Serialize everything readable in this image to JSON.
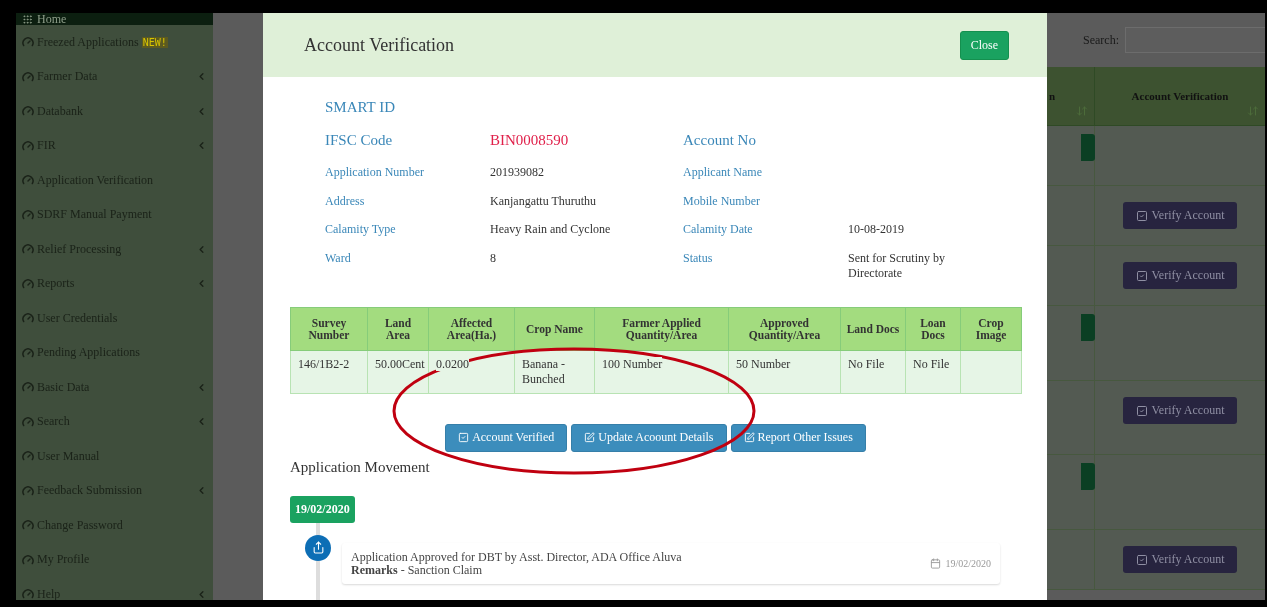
{
  "sidebar": {
    "items": [
      {
        "label": "Home",
        "kind": "header",
        "expandable": false
      },
      {
        "label": "Freezed Applications",
        "kind": "item",
        "badge": "NEW!",
        "expandable": false
      },
      {
        "label": "Farmer Data",
        "kind": "item",
        "expandable": true
      },
      {
        "label": "Databank",
        "kind": "item",
        "expandable": true
      },
      {
        "label": "FIR",
        "kind": "item",
        "expandable": true
      },
      {
        "label": "Application Verification",
        "kind": "item",
        "expandable": false
      },
      {
        "label": "SDRF Manual Payment",
        "kind": "item",
        "expandable": false
      },
      {
        "label": "Relief Processing",
        "kind": "item",
        "expandable": true
      },
      {
        "label": "Reports",
        "kind": "item",
        "expandable": true
      },
      {
        "label": "User Credentials",
        "kind": "item",
        "expandable": false
      },
      {
        "label": "Pending Applications",
        "kind": "item",
        "expandable": false
      },
      {
        "label": "Basic Data",
        "kind": "item",
        "expandable": true
      },
      {
        "label": "Search",
        "kind": "item",
        "expandable": true
      },
      {
        "label": "User Manual",
        "kind": "item",
        "expandable": false
      },
      {
        "label": "Feedback Submission",
        "kind": "item",
        "expandable": true
      },
      {
        "label": "Change Password",
        "kind": "item",
        "expandable": false
      },
      {
        "label": "My Profile",
        "kind": "item",
        "expandable": false
      },
      {
        "label": "Help",
        "kind": "item",
        "expandable": true
      }
    ]
  },
  "background": {
    "search_label": "Search:",
    "columns": [
      "n",
      "Account Verification"
    ],
    "rows": [
      {
        "kind": "action"
      },
      {
        "kind": "verify",
        "label": "Verify Account"
      },
      {
        "kind": "verify",
        "label": "Verify Account"
      },
      {
        "kind": "action"
      },
      {
        "kind": "verify",
        "label": "Verify Account"
      },
      {
        "kind": "action"
      },
      {
        "kind": "verify",
        "label": "Verify Account"
      }
    ]
  },
  "modal": {
    "title": "Account Verification",
    "close_button": "Close",
    "smart_id_label": "SMART ID",
    "main_fields": [
      {
        "label": "IFSC Code",
        "value": "BIN0008590"
      },
      {
        "label": "Account No"
      }
    ],
    "fields": [
      {
        "label": "Application Number",
        "value": "201939082"
      },
      {
        "label": "Applicant Name"
      },
      {
        "label": "Address",
        "value": "Kanjangattu Thuruthu"
      },
      {
        "label": "Mobile Number"
      },
      {
        "label": "Calamity Type",
        "value": "Heavy Rain and Cyclone"
      },
      {
        "label": "Calamity Date",
        "value": "10-08-2019"
      },
      {
        "label": "Ward",
        "value": "8"
      },
      {
        "label": "Status",
        "value": "Sent for Scrutiny by Directorate"
      }
    ],
    "table": {
      "columns": [
        "Survey Number",
        "Land Area",
        "Affected Area(Ha.)",
        "Crop Name",
        "Farmer Applied Quantity/Area",
        "Approved Quantity/Area",
        "Land Docs",
        "Loan Docs",
        "Crop Image"
      ],
      "rows": [
        [
          "146/1B2-2",
          "50.00Cent",
          "0.0200",
          "Banana - Bunched",
          "100 Number",
          "50 Number",
          "No File",
          "No File"
        ]
      ]
    },
    "actions": [
      {
        "label": "Account Verified"
      },
      {
        "label": "Update Acoount Details"
      },
      {
        "label": "Report Other Issues"
      }
    ],
    "movement": {
      "heading": "Application Movement",
      "groups": [
        {
          "date": "19/02/2020",
          "entries": [
            {
              "text": "Application Approved for DBT by Asst. Director, ADA Office Aluva",
              "remarks": "**Remarks** - Sanction Claim",
              "date": "19/02/2020"
            }
          ]
        }
      ]
    }
  }
}
